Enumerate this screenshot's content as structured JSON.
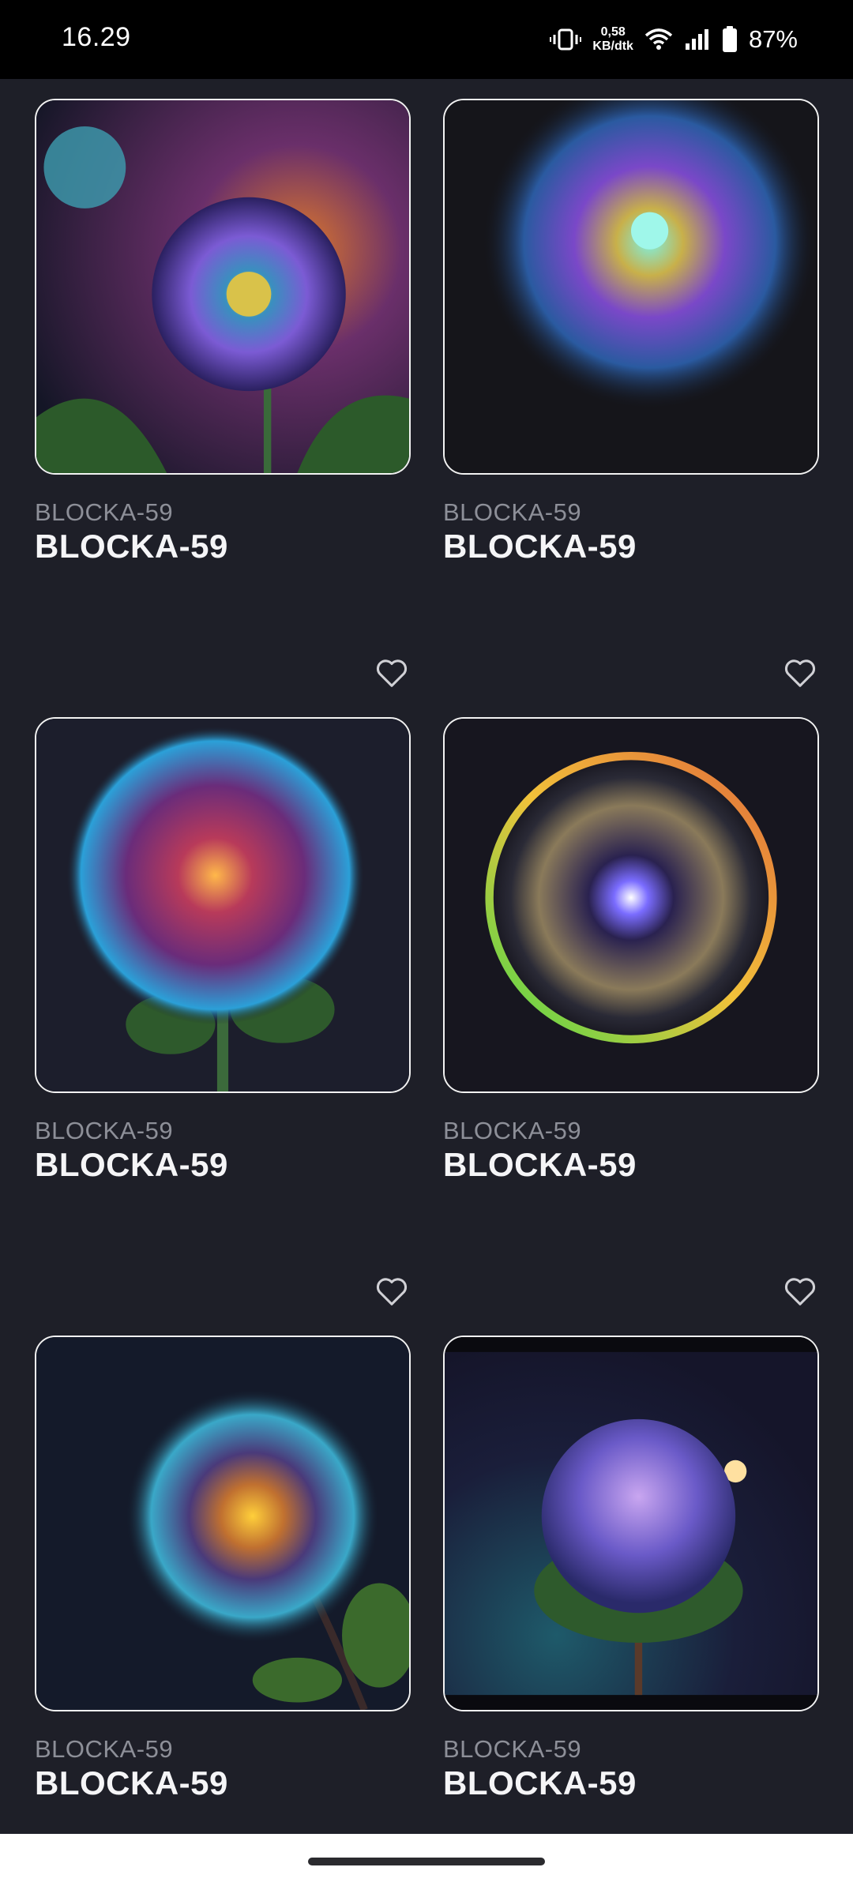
{
  "status_bar": {
    "time": "16.29",
    "net_speed_value": "0,58",
    "net_speed_unit": "KB/dtk",
    "battery_percent": "87%",
    "icons": [
      "vibrate-icon",
      "wifi-icon",
      "cellular-signal-icon",
      "battery-icon"
    ]
  },
  "gallery": {
    "items": [
      {
        "subtitle": "BLOCKA-59",
        "title": "BLOCKA-59",
        "favorite_icon": "heart-outline-icon"
      },
      {
        "subtitle": "BLOCKA-59",
        "title": "BLOCKA-59",
        "favorite_icon": "heart-outline-icon"
      },
      {
        "subtitle": "BLOCKA-59",
        "title": "BLOCKA-59",
        "favorite_icon": "heart-outline-icon"
      },
      {
        "subtitle": "BLOCKA-59",
        "title": "BLOCKA-59",
        "favorite_icon": "heart-outline-icon"
      },
      {
        "subtitle": "BLOCKA-59",
        "title": "BLOCKA-59",
        "favorite_icon": "heart-outline-icon"
      },
      {
        "subtitle": "BLOCKA-59",
        "title": "BLOCKA-59",
        "favorite_icon": "heart-outline-icon"
      }
    ]
  },
  "colors": {
    "background": "#1e1f28",
    "card_border": "#f2f2f2",
    "subtitle": "#8d8f98",
    "title": "#f5f5f7"
  }
}
